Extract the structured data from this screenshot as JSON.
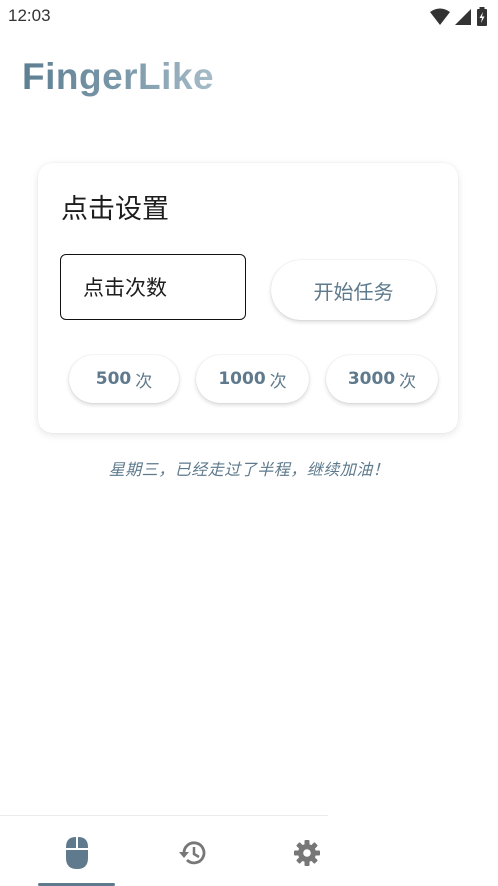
{
  "status_bar": {
    "time": "12:03",
    "icons": [
      "wifi-icon",
      "signal-icon",
      "battery-icon"
    ]
  },
  "app": {
    "title": "FingerLike"
  },
  "click_settings": {
    "title": "点击设置",
    "count_input": {
      "value": "",
      "placeholder": "点击次数"
    },
    "start_button_label": "开始任务",
    "presets": [
      {
        "value": "500",
        "unit": "次"
      },
      {
        "value": "1000",
        "unit": "次"
      },
      {
        "value": "3000",
        "unit": "次"
      }
    ]
  },
  "motto": "星期三，已经走过了半程，继续加油！",
  "bottom_nav": {
    "items": [
      {
        "icon": "mouse-icon",
        "selected": true
      },
      {
        "icon": "history-icon",
        "selected": false
      },
      {
        "icon": "settings-gear-icon",
        "selected": false
      }
    ]
  },
  "colors": {
    "accent": "#5e7a8c",
    "title_gradient_start": "#5d7f92",
    "title_gradient_end": "#a7bcc8",
    "nav_icon": "#777777"
  }
}
